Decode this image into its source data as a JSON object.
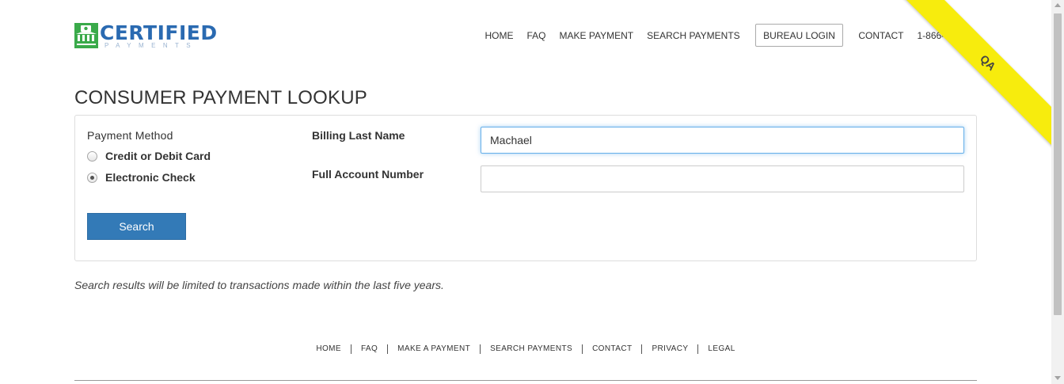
{
  "header": {
    "logo_main": "CERTIFIED",
    "logo_sub": "PAYMENTS",
    "nav": [
      "HOME",
      "FAQ",
      "MAKE PAYMENT",
      "SEARCH PAYMENTS",
      "BUREAU LOGIN",
      "CONTACT",
      "1-866-5"
    ],
    "ribbon": "QA"
  },
  "page": {
    "title": "CONSUMER PAYMENT LOOKUP"
  },
  "form": {
    "payment_method_label": "Payment Method",
    "options": [
      {
        "label": "Credit or Debit Card",
        "checked": false
      },
      {
        "label": "Electronic Check",
        "checked": true
      }
    ],
    "billing_last_name_label": "Billing Last Name",
    "billing_last_name_value": "Machael",
    "account_number_label": "Full Account Number",
    "account_number_value": "",
    "search_label": "Search"
  },
  "note": "Search results will be limited to transactions made within the last five years.",
  "footer": {
    "links": [
      "HOME",
      "FAQ",
      "MAKE A PAYMENT",
      "SEARCH PAYMENTS",
      "CONTACT",
      "PRIVACY",
      "LEGAL"
    ]
  },
  "colors": {
    "brand_blue": "#2a6ab1",
    "brand_green": "#3aaa4a",
    "button_blue": "#337ab7",
    "ribbon_yellow": "#f7ec0d"
  },
  "icons": [
    "logo-building-icon"
  ]
}
